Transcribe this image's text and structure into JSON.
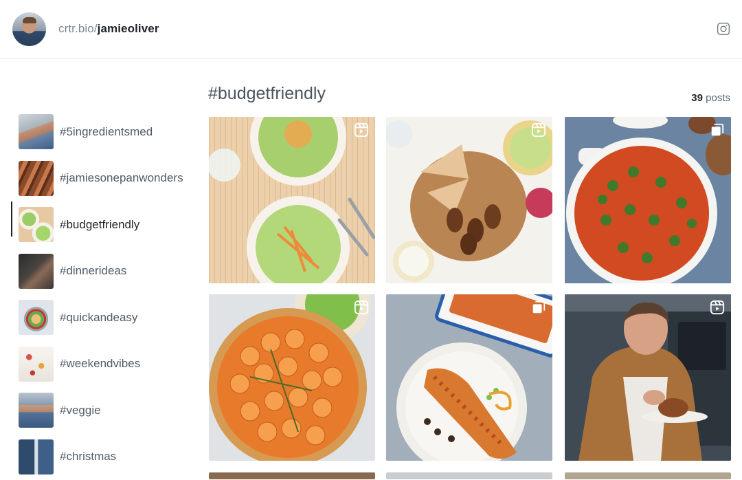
{
  "header": {
    "domain": "crtr.bio/",
    "handle": "jamieoliver",
    "social_icon": "instagram-icon"
  },
  "sidebar": {
    "items": [
      {
        "label": "#5ingredientsmed",
        "active": false
      },
      {
        "label": "#jamiesonepanwonders",
        "active": false
      },
      {
        "label": "#budgetfriendly",
        "active": true
      },
      {
        "label": "#dinnerideas",
        "active": false
      },
      {
        "label": "#quickandeasy",
        "active": false
      },
      {
        "label": "#weekendvibes",
        "active": false
      },
      {
        "label": "#veggie",
        "active": false
      },
      {
        "label": "#christmas",
        "active": false
      }
    ]
  },
  "main": {
    "title": "#budgetfriendly",
    "post_count": "39",
    "post_count_unit": "posts"
  },
  "posts": [
    {
      "type": "reel",
      "icon": "reels-icon",
      "subject": "flatbreads with avocado and carrot"
    },
    {
      "type": "reel",
      "icon": "reels-icon",
      "subject": "koftas with flatbread"
    },
    {
      "type": "carousel",
      "icon": "carousel-icon",
      "subject": "broccoli tomato bake"
    },
    {
      "type": "reel",
      "icon": "reels-icon",
      "subject": "sweet potato bake"
    },
    {
      "type": "carousel",
      "icon": "carousel-icon",
      "subject": "enchilada"
    },
    {
      "type": "reel",
      "icon": "reels-icon",
      "subject": "chef plating chicken"
    }
  ],
  "colors": {
    "accent": "#1f2328",
    "muted": "#515c68",
    "divider": "#e3e5e8"
  }
}
